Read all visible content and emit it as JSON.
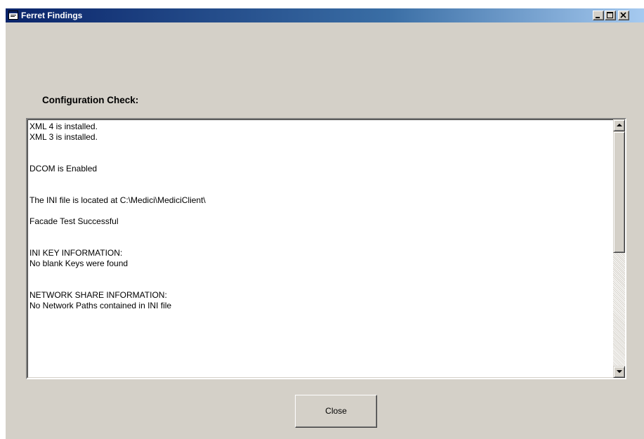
{
  "window": {
    "title": "Ferret Findings",
    "icon": "app-window-icon",
    "controls": [
      "minimize-icon",
      "maximize-icon",
      "close-icon"
    ]
  },
  "section": {
    "label": "Configuration Check:"
  },
  "results": {
    "lines": [
      "XML 4 is installed.",
      "XML 3 is installed.",
      "",
      "",
      "DCOM is Enabled",
      "",
      "",
      "The INI file is located at C:\\Medici\\MediciClient\\",
      "",
      "Facade Test Successful",
      "",
      "",
      "INI KEY INFORMATION:",
      "No blank Keys were found",
      "",
      "",
      "NETWORK SHARE INFORMATION:",
      "No Network Paths contained in INI file"
    ],
    "scroll_position": 0.0
  },
  "footer": {
    "close_label": "Close"
  },
  "colors": {
    "title_start": "#0a246a",
    "title_end": "#a6caf0",
    "face": "#d4d0c8"
  }
}
